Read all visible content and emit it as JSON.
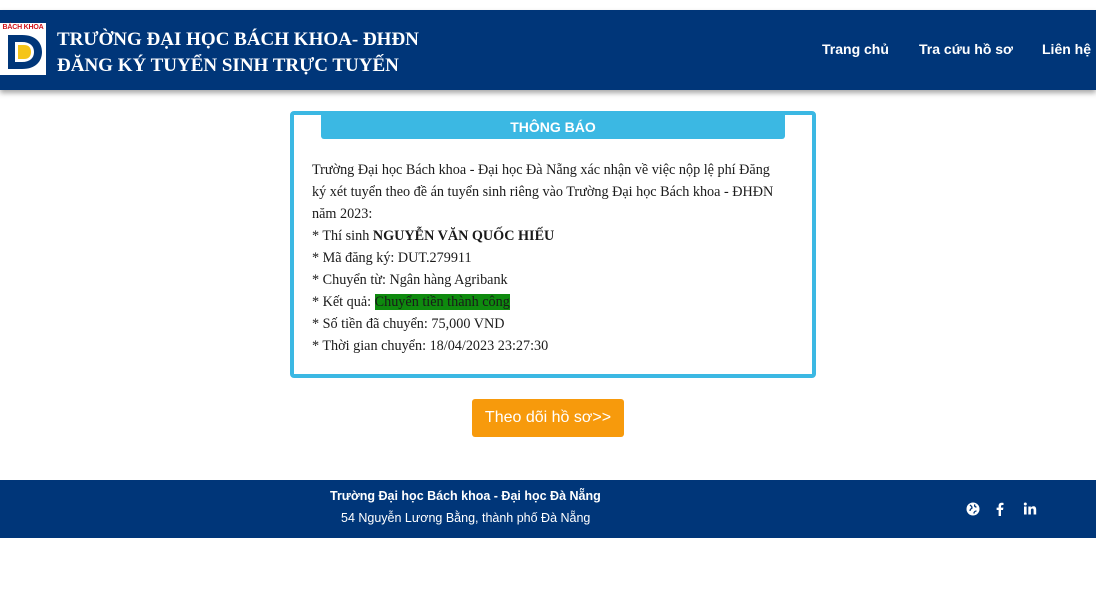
{
  "header": {
    "logo_text": "BÁCH KHOA",
    "title_line1": "TRƯỜNG ĐẠI HỌC BÁCH KHOA- ĐHĐN",
    "title_line2": "ĐĂNG KÝ TUYỂN SINH TRỰC TUYẾN",
    "nav": [
      {
        "label": "Trang chủ"
      },
      {
        "label": "Tra cứu hồ sơ"
      },
      {
        "label": "Liên hệ"
      }
    ]
  },
  "notice": {
    "title": "THÔNG BÁO",
    "intro_1": "Trường Đại học Bách khoa - Đại học Đà Nẵng xác nhận về việc nộp lệ phí Đăng",
    "intro_2": "ký xét tuyển theo đề án tuyển sinh riêng vào Trường Đại học Bách khoa - ĐHĐN",
    "intro_3": "năm 2023:",
    "candidate_label": "* Thí sinh ",
    "candidate_name": "NGUYỄN VĂN QUỐC HIẾU",
    "reg_code_label": "* Mã đăng ký: ",
    "reg_code": "DUT.279911",
    "source_label": "* Chuyển từ: ",
    "source": "Ngân hàng Agribank",
    "result_label": "* Kết quả: ",
    "result": "Chuyển tiền thành công",
    "amount_label": "* Số tiền đã chuyển: ",
    "amount": "75,000 VND",
    "time_label": "* Thời gian chuyển: ",
    "time": "18/04/2023 23:27:30"
  },
  "actions": {
    "track_button": "Theo dõi hồ sơ>>"
  },
  "footer": {
    "line1": "Trường Đại học Bách khoa - Đại học Đà Nẵng",
    "line2": "54 Nguyễn Lương Bằng, thành phố Đà Nẵng",
    "social": [
      "globe-icon",
      "facebook-icon",
      "linkedin-icon"
    ]
  },
  "colors": {
    "brand_navy": "#003679",
    "accent_blue": "#3bb8e3",
    "button_orange": "#f79a0c",
    "success_green": "#0e8a0e"
  }
}
